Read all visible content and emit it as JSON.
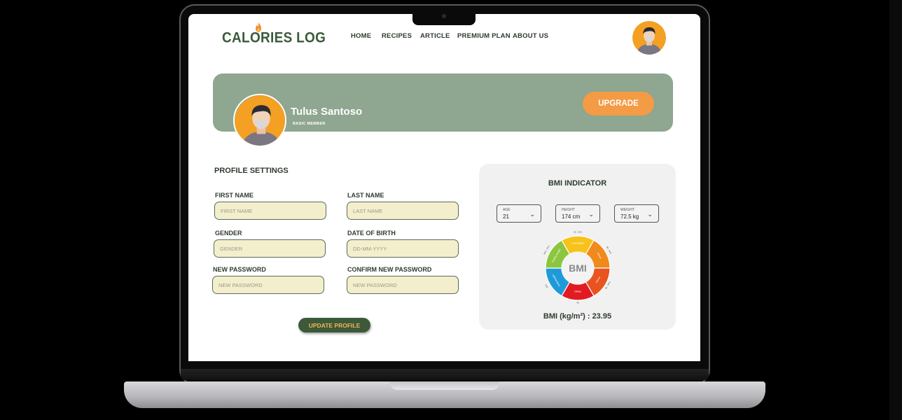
{
  "app": {
    "logo": "CALORIES LOG"
  },
  "nav": {
    "items": [
      "HOME",
      "RECIPES",
      "ARTICLE",
      "PREMIUM PLAN",
      "ABOUT US"
    ]
  },
  "profile": {
    "name": "Tulus Santoso",
    "membership": "BASIC MEMBER",
    "upgrade_label": "UPGRADE"
  },
  "settings": {
    "title": "PROFILE SETTINGS",
    "first_name": {
      "label": "FIRST NAME",
      "placeholder": "FIRST NAME"
    },
    "last_name": {
      "label": "LAST NAME",
      "placeholder": "LAST NAME"
    },
    "gender": {
      "label": "GENDER",
      "placeholder": "GENDER"
    },
    "dob": {
      "label": "DATE OF BIRTH",
      "placeholder": "DD-MM-YYYY"
    },
    "new_password": {
      "label": "NEW PASSWORD",
      "placeholder": "NEW PASSWORD"
    },
    "confirm_password": {
      "label": "CONFIRM NEW PASSWORD",
      "placeholder": "NEW PASSWORD"
    },
    "update_label": "UPDATE PROFILE"
  },
  "bmi": {
    "title": "BMI INDICATOR",
    "age": {
      "label": "AGE",
      "value": "21"
    },
    "height": {
      "label": "HEIGHT",
      "value": "174 cm"
    },
    "weight": {
      "label": "WEIGHT",
      "value": "72.5 kg"
    },
    "center_label": "BMI",
    "result": "BMI (kg/m²) : 23.95",
    "segments": [
      "Underweight",
      "Healthy weight",
      "Overweight",
      "Obese",
      "Obese",
      "Obese"
    ],
    "range_labels": [
      "18.5",
      "18.5 - 24.9",
      "25 - 29.9",
      "30 - 34.9",
      "35 - 39.9",
      "40"
    ]
  },
  "colors": {
    "brand": "#3c5a3a",
    "accent": "#f49b45",
    "banner": "#8fa690",
    "field": "#f3efcc"
  }
}
